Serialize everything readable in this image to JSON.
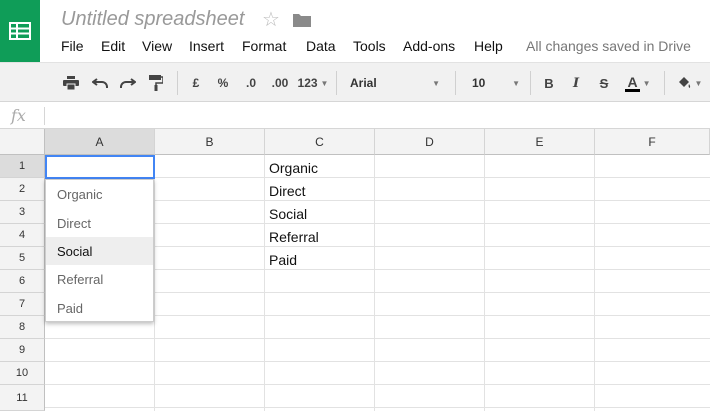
{
  "header": {
    "doc_title": "Untitled spreadsheet",
    "save_status": "All changes saved in Drive",
    "menu": [
      "File",
      "Edit",
      "View",
      "Insert",
      "Format",
      "Data",
      "Tools",
      "Add-ons",
      "Help"
    ]
  },
  "toolbar": {
    "currency": "£",
    "percent": "%",
    "decrease_decimal": ".0",
    "increase_decimal": ".00",
    "number_format": "123",
    "font": "Arial",
    "font_size": "10",
    "bold": "B",
    "italic": "I",
    "strike": "S",
    "text_color": "A"
  },
  "formula_bar": {
    "fx_label": "fx"
  },
  "grid": {
    "columns": [
      "A",
      "B",
      "C",
      "D",
      "E",
      "F"
    ],
    "rows": [
      "1",
      "2",
      "3",
      "4",
      "5",
      "6",
      "7",
      "8",
      "9",
      "10",
      "11"
    ],
    "column_c_values": [
      "Organic",
      "Direct",
      "Social",
      "Referral",
      "Paid"
    ],
    "selected_cell": "A1"
  },
  "dropdown": {
    "options": [
      "Organic",
      "Direct",
      "Social",
      "Referral",
      "Paid"
    ],
    "hovered": "Social"
  },
  "colors": {
    "brand_green": "#0f9d58",
    "selection_blue": "#4285f4"
  }
}
